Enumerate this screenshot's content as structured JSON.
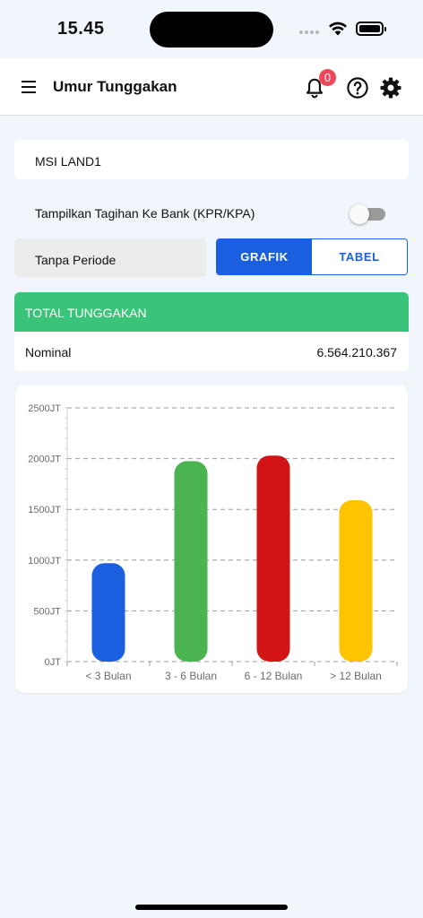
{
  "status_bar": {
    "time": "15.45"
  },
  "app_bar": {
    "title": "Umur Tunggakan",
    "notification_count": "0"
  },
  "location": {
    "name": "MSI LAND1"
  },
  "toggle": {
    "label": "Tampilkan Tagihan Ke Bank (KPR/KPA)",
    "on": false
  },
  "period": {
    "value": "Tanpa Periode"
  },
  "view_switch": {
    "grafik_label": "GRAFIK",
    "tabel_label": "TABEL",
    "selected": "GRAFIK"
  },
  "total": {
    "header": "TOTAL TUNGGAKAN",
    "label": "Nominal",
    "value": "6.564.210.367"
  },
  "colors": {
    "primary": "#1a5fe0",
    "header_green": "#3ac479",
    "badge_red": "#f0465a"
  },
  "chart_data": {
    "type": "bar",
    "categories": [
      "< 3 Bulan",
      "3 - 6 Bulan",
      "6 - 12 Bulan",
      "> 12 Bulan"
    ],
    "values": [
      970,
      1975,
      2030,
      1590
    ],
    "colors": [
      "#1a5fe0",
      "#4bb350",
      "#d21414",
      "#ffc400"
    ],
    "ylim": [
      0,
      2500
    ],
    "yticks": [
      0,
      500,
      1000,
      1500,
      2000,
      2500
    ],
    "ytick_labels": [
      "0JT",
      "500JT",
      "1000JT",
      "1500JT",
      "2000JT",
      "2500JT"
    ],
    "grid": true,
    "title": "",
    "xlabel": "",
    "ylabel": ""
  }
}
